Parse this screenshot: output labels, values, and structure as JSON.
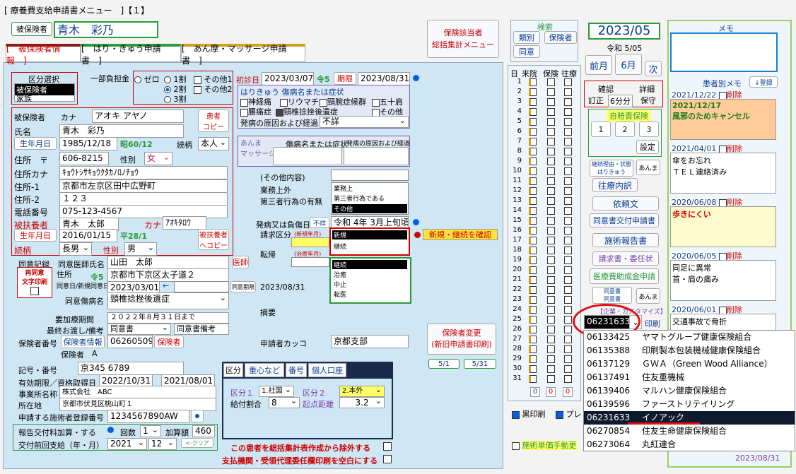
{
  "window": {
    "title": "[ 療養費支給申請書メニュー　]【１】"
  },
  "header": {
    "insured_btn": "被保険者",
    "name": "青木　彩乃",
    "insurer_menu": "保険該当者\n総括集計メニュー"
  },
  "tabs": [
    "[　被保険者情報　]",
    "[　はり・きゅう申請書　]",
    "[　あん摩・マッサージ申請書　]"
  ],
  "kubun": {
    "title": "区分選択",
    "items": [
      "被保険者",
      "家族"
    ]
  },
  "partial": {
    "label": "一部負担金",
    "options": [
      "ゼロ",
      "1割",
      "2割",
      "3割"
    ],
    "selected": "2割",
    "other1": "その他1",
    "other2": "その他2"
  },
  "first_visit": {
    "label": "初診日",
    "value": "2023/03/07",
    "era": "令5",
    "period_label": "期限",
    "period": "2023/08/31"
  },
  "hari": {
    "title": "はりきゅう 傷病名または症状",
    "items": [
      "神経痛",
      "リウマチ",
      "頸腕症候群",
      "五十肩",
      "腰痛症",
      "頸椎捻挫後遺症",
      "その他"
    ],
    "checked": "頸椎捻挫後遺症",
    "cause_label": "発病の原因および経過",
    "cause_value": "不詳"
  },
  "anma": {
    "title": "あんま\nマッサージ",
    "col1": "傷病名または症状",
    "col2": "発病の原因および経過"
  },
  "person": {
    "insured_label": "被保険者",
    "kana_label": "カナ",
    "kana": "アオキ アヤノ",
    "name_label": "氏名",
    "name": "青木　彩乃",
    "copy_btn": "患者\nコピー",
    "birth_btn": "生年月日",
    "birth": "1985/12/18",
    "birth_era": "昭60/12",
    "rel_label": "続柄",
    "rel": "本人",
    "addr_label": "住所　〒",
    "zip": "606-8215",
    "sex_label": "性別",
    "sex": "女",
    "addrkana_label": "住所カナ",
    "addrkana": "ｷｮｳﾄｼｻｷｮｳｸﾀｶﾉﾛﾉﾁｮｳ",
    "addr1_label": "住所-1",
    "addr1": "京都市左京区田中広野町",
    "addr2_label": "住所-2",
    "addr2": "１２３",
    "tel_label": "電話番号",
    "tel": "075-123-4567",
    "dep_label": "被扶養者",
    "dep_name": "青木　太郎",
    "dep_kana_label": "カナ",
    "dep_kana": "ｱｵｷﾀﾛｳ",
    "dep_birth_btn": "生年月日",
    "dep_birth": "2016/01/15",
    "dep_era": "平28/1",
    "dep_copy": "被扶養者\nへコピー",
    "dep_rel_label": "続柄",
    "dep_rel": "長男",
    "dep_sex_label": "性別",
    "dep_sex": "男"
  },
  "other": {
    "title": "(その他内容)",
    "work_label": "業務上外",
    "third_label": "第三者行為の有無",
    "work_list": [
      "業務上",
      "第三者行為である",
      "その他"
    ],
    "onset_label": "発病又は負傷日",
    "unknown": "不詳",
    "onset": "令和 4年 3月上旬頃",
    "claim_label": "請求区分",
    "new_label": "(新規年月)",
    "claim_list": [
      "新規",
      "継続"
    ],
    "confirm": "新規・継続を確認",
    "tenki_label": "転帰",
    "chiyu_label": "(治癒年月)",
    "tenki_list": [
      "継続",
      "治癒",
      "中止",
      "転医"
    ],
    "tekiyo_label": "摘要",
    "kakko_label": "申請者カッコ",
    "kakko": "京都支部"
  },
  "doctor": {
    "consent_label": "同意記録",
    "doc_label": "同意医師氏名",
    "doc": "山田　太郎",
    "doc_btn": "医師",
    "reprint": "再同意\n文字印刷",
    "addr_label": "住所",
    "era": "令5",
    "addr": "京都市下京区太子道２",
    "date_label": "同意日/新規同意日",
    "date": "2023/03/01",
    "limit_label": "同意期限",
    "limit": "2023/08/31",
    "disease_label": "同意傷病名",
    "disease": "頸椎捻挫後遺症",
    "period_label": "要加療期間",
    "period": "２０２２年８月３１日まで",
    "last_label": "最終お渡し/備考",
    "last": "同意書",
    "note": "同意書備考"
  },
  "insurer": {
    "no_label": "保険者番号",
    "info_btn": "保険者情報",
    "no": "06260509",
    "ins_btn": "保険者",
    "ins_name_label": "保険者",
    "ins_name": "A",
    "kigo_label": "記号・番号",
    "kigo": "京345 6789",
    "valid_label": "有効期限／資格取得日",
    "valid": "2022/10/31",
    "acq": "2021/08/01",
    "biz_label": "事業所名称",
    "biz": "株式会社　ABC",
    "loc_label": "所在地",
    "loc": "京都市伏見区桃山町１",
    "reg_label": "申請する施術者登録番号",
    "reg": "1234567890AW",
    "report_label": "報告交付料加算・する",
    "count_label": "回数",
    "count": "1",
    "amount_label": "加算額",
    "amount": "460",
    "last_label": "交付前回支給（年・月）",
    "last_year": "2021",
    "last_month": "12",
    "clear": "<-クリア"
  },
  "kubun2": {
    "tabs": [
      "区分",
      "重心など",
      "番号",
      "個人口座"
    ],
    "k1_label": "区分１",
    "k1": "1.社国",
    "k2_label": "区分２",
    "k2": "2.本外",
    "ratio_label": "給付割合",
    "ratio": "8",
    "dist_label": "起点距離",
    "dist": "3.2"
  },
  "exclude": {
    "l1": "この患者を総括集計表作成から除外する",
    "l2": "支払機関・受領代理委任欄印刷を空白にする"
  },
  "insurer_change": {
    "label": "保険者変更\n(新旧申請書印刷)",
    "d1": "5/1",
    "d2": "5/31"
  },
  "kensaku": {
    "title": "検索",
    "b1": "類別",
    "b2": "保険者",
    "b3": "同意"
  },
  "days": {
    "headers": [
      "日",
      "来院",
      "保険",
      "往療"
    ],
    "rows": [
      "1",
      "2",
      "3",
      "4",
      "5",
      "6",
      "7",
      "8",
      "9",
      "10",
      "11",
      "12",
      "13",
      "14",
      "15",
      "16",
      "17",
      "18",
      "19",
      "20",
      "21",
      "22",
      "23",
      "24",
      "25",
      "26",
      "27",
      "28",
      "29",
      "30",
      "31"
    ],
    "totals": [
      "0",
      "0",
      "0"
    ]
  },
  "month": {
    "label": "2023/05",
    "era": "令和 5/05",
    "prev": "前月",
    "cur": "6月",
    "next": "次"
  },
  "confirm": {
    "b1": "確認",
    "b2": "詳細",
    "b3": "訂正",
    "b4": "6分分",
    "b5": "保守"
  },
  "jibai": {
    "title": "自賠責保険",
    "b": [
      "1",
      "2",
      "3"
    ],
    "setting": "設定"
  },
  "menu": {
    "keika": "継続理由・状態\nはりきゅう",
    "anma": "あんま",
    "ouryo": "往療内訳",
    "irai": "依頼文",
    "douisho": "同意書交付申請書",
    "sejutsu": "施術報告書",
    "seikyu": "請求書・委任状",
    "iryo": "医療費助成金申請",
    "dousho2": "同意書\n同意書",
    "anma2": "あんま",
    "custom": "【企業・カスタマイズ】",
    "print": "印刷",
    "kuro": "黒印刷",
    "pure": "プレ",
    "tanka": "施術単価手動更"
  },
  "combo": {
    "value": "06231633"
  },
  "dropdown": [
    {
      "code": "06133425",
      "name": "ヤマトグループ健康保険組合"
    },
    {
      "code": "06135388",
      "name": "印刷製本包装機械健康保険組合"
    },
    {
      "code": "06137129",
      "name": "ＧＷＡ（Green Wood Alliance）"
    },
    {
      "code": "06137491",
      "name": "住友重機械"
    },
    {
      "code": "06139406",
      "name": "マルハン健康保険組合"
    },
    {
      "code": "06139596",
      "name": "ファーストリテイリング"
    },
    {
      "code": "06231633",
      "name": "イノアック"
    },
    {
      "code": "06270854",
      "name": "住友生命健康保険組合"
    },
    {
      "code": "06273064",
      "name": "丸紅連合"
    }
  ],
  "memo": {
    "title": "メモ",
    "list_title": "患者別メモ",
    "register": "↓登録",
    "entries": [
      {
        "date": "2021/12/22",
        "del": "削除",
        "text": "2021/12/17\n風邪のためキャンセル"
      },
      {
        "date": "2021/04/01",
        "del": "削除",
        "text": "傘をお忘れ\nＴＥＬ連絡済み"
      },
      {
        "date": "2020/06/08",
        "del": "削除",
        "text": "歩きにくい"
      },
      {
        "date": "2020/06/05",
        "del": "削除",
        "text": "同足に異常\n首・肩の痛み"
      },
      {
        "date": "2020/06/01",
        "del": "削除",
        "text": "交通事故で骨折"
      }
    ],
    "footer_date": "2023/08/31"
  },
  "colors": {
    "panel": "#cfe6f4",
    "red": "#c00000",
    "green": "#2a9a3a",
    "navy": "#0e1a2e"
  }
}
